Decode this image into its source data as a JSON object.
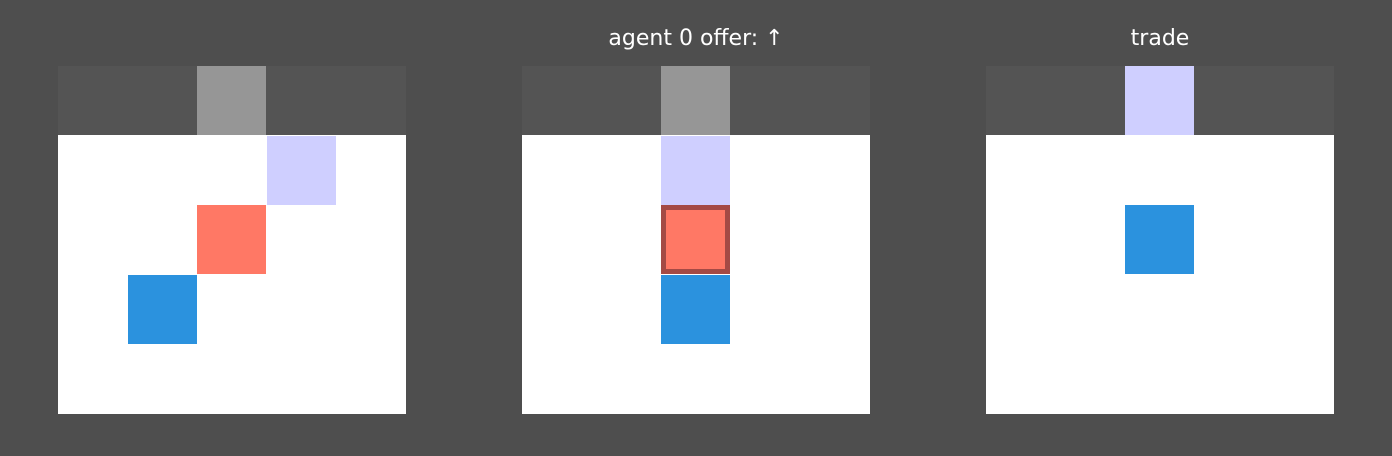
{
  "panels": [
    {
      "title": "",
      "cells": [
        {
          "name": "gray-slot-cell",
          "col": 2,
          "row": 0,
          "color": "#969696",
          "highlight": false
        },
        {
          "name": "lavender-cell",
          "col": 3,
          "row": 1,
          "color": "#cfcfff",
          "highlight": false
        },
        {
          "name": "agent-red-cell",
          "col": 2,
          "row": 2,
          "color": "#ff7865",
          "highlight": false
        },
        {
          "name": "agent-blue-cell",
          "col": 1,
          "row": 3,
          "color": "#2b92de",
          "highlight": false
        }
      ]
    },
    {
      "title": "agent 0 offer: ↑",
      "cells": [
        {
          "name": "gray-slot-cell",
          "col": 2,
          "row": 0,
          "color": "#969696",
          "highlight": false
        },
        {
          "name": "lavender-cell",
          "col": 2,
          "row": 1,
          "color": "#cfcfff",
          "highlight": false
        },
        {
          "name": "agent-red-cell",
          "col": 2,
          "row": 2,
          "color": "#ff7865",
          "highlight": true
        },
        {
          "name": "agent-blue-cell",
          "col": 2,
          "row": 3,
          "color": "#2b92de",
          "highlight": false
        }
      ]
    },
    {
      "title": "trade",
      "cells": [
        {
          "name": "lavender-cell",
          "col": 2,
          "row": 0,
          "color": "#cfcfff",
          "highlight": false
        },
        {
          "name": "agent-blue-cell",
          "col": 2,
          "row": 2,
          "color": "#2b92de",
          "highlight": false
        }
      ]
    }
  ],
  "colors": {
    "background": "#4e4e4e",
    "board": "#ffffff",
    "top_strip": "#545454",
    "highlight_border": "#a44a45"
  }
}
